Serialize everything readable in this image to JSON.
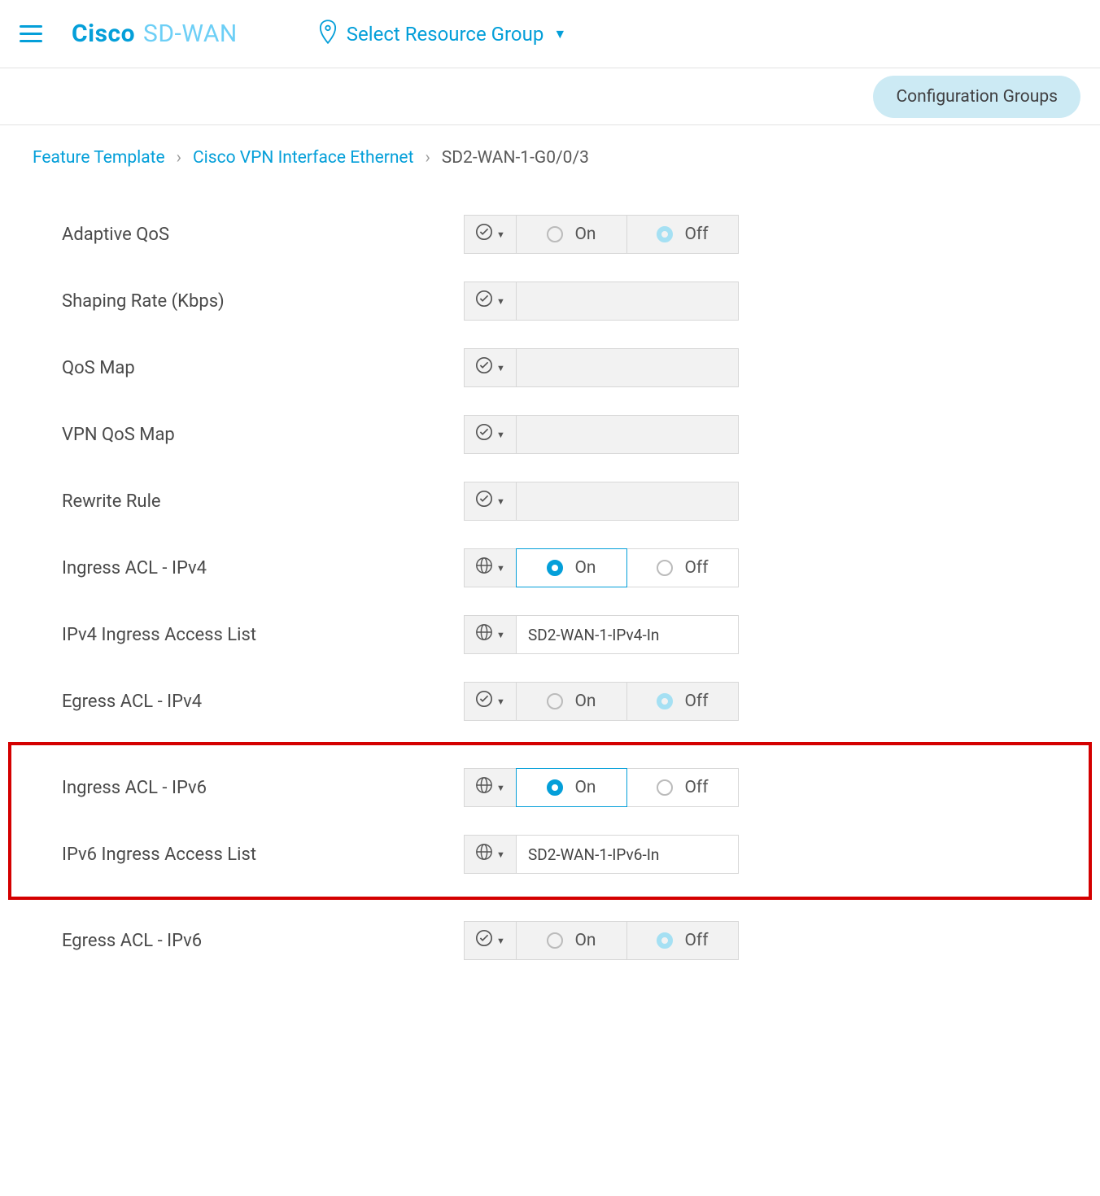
{
  "header": {
    "brand_cisco": "Cisco",
    "brand_product": "SD-WAN",
    "resource_group_label": "Select Resource Group"
  },
  "subbar": {
    "config_groups_label": "Configuration Groups"
  },
  "breadcrumb": {
    "items": [
      {
        "label": "Feature Template",
        "link": true
      },
      {
        "label": "Cisco VPN Interface Ethernet",
        "link": true
      },
      {
        "label": "SD2-WAN-1-G0/0/3",
        "link": false
      }
    ]
  },
  "options": {
    "on": "On",
    "off": "Off"
  },
  "rows": [
    {
      "id": "adaptive-qos",
      "label": "Adaptive QoS",
      "mode": "check",
      "type": "onoff",
      "value": "off",
      "disabled": true
    },
    {
      "id": "shaping-rate",
      "label": "Shaping Rate (Kbps)",
      "mode": "check",
      "type": "text",
      "value": "",
      "disabled": true
    },
    {
      "id": "qos-map",
      "label": "QoS Map",
      "mode": "check",
      "type": "text",
      "value": "",
      "disabled": true
    },
    {
      "id": "vpn-qos-map",
      "label": "VPN QoS Map",
      "mode": "check",
      "type": "text",
      "value": "",
      "disabled": true
    },
    {
      "id": "rewrite-rule",
      "label": "Rewrite Rule",
      "mode": "check",
      "type": "text",
      "value": "",
      "disabled": true
    },
    {
      "id": "ingress-acl-ipv4",
      "label": "Ingress ACL - IPv4",
      "mode": "globe",
      "type": "onoff",
      "value": "on",
      "disabled": false
    },
    {
      "id": "ipv4-ingress-access-list",
      "label": "IPv4 Ingress Access List",
      "mode": "globe",
      "type": "text",
      "value": "SD2-WAN-1-IPv4-In",
      "disabled": false
    },
    {
      "id": "egress-acl-ipv4",
      "label": "Egress ACL - IPv4",
      "mode": "check",
      "type": "onoff",
      "value": "off",
      "disabled": true
    },
    {
      "id": "ingress-acl-ipv6",
      "label": "Ingress ACL - IPv6",
      "mode": "globe",
      "type": "onoff",
      "value": "on",
      "disabled": false,
      "highlight": true
    },
    {
      "id": "ipv6-ingress-access-list",
      "label": "IPv6 Ingress Access List",
      "mode": "globe",
      "type": "text",
      "value": "SD2-WAN-1-IPv6-In",
      "disabled": false,
      "highlight": true
    },
    {
      "id": "egress-acl-ipv6",
      "label": "Egress ACL - IPv6",
      "mode": "check",
      "type": "onoff",
      "value": "off",
      "disabled": true
    }
  ]
}
